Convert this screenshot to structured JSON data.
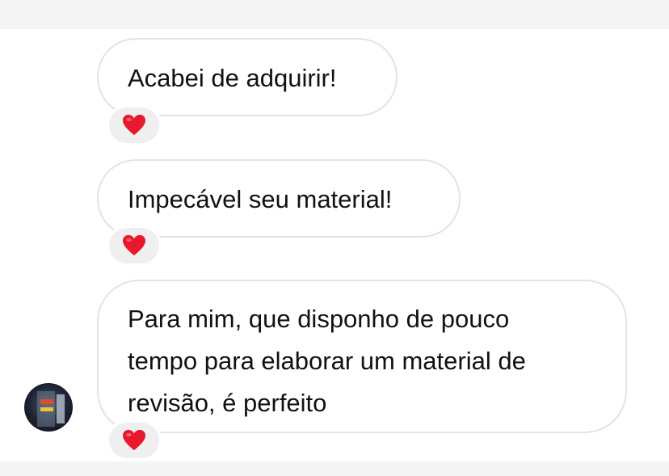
{
  "messages": [
    {
      "lines": [
        "Acabei de adquirir!"
      ],
      "reaction": "heart-emoji"
    },
    {
      "lines": [
        "Impecável seu material!"
      ],
      "reaction": "heart-emoji"
    },
    {
      "lines": [
        "Para mim, que disponho de pouco",
        "tempo para elaborar um material de",
        "revisão, é perfeito"
      ],
      "reaction": "heart-emoji"
    }
  ],
  "colors": {
    "bubble_border": "#e3e3e3",
    "reaction_bg": "#efefef",
    "heart": "#e8192c",
    "text": "#111111"
  }
}
